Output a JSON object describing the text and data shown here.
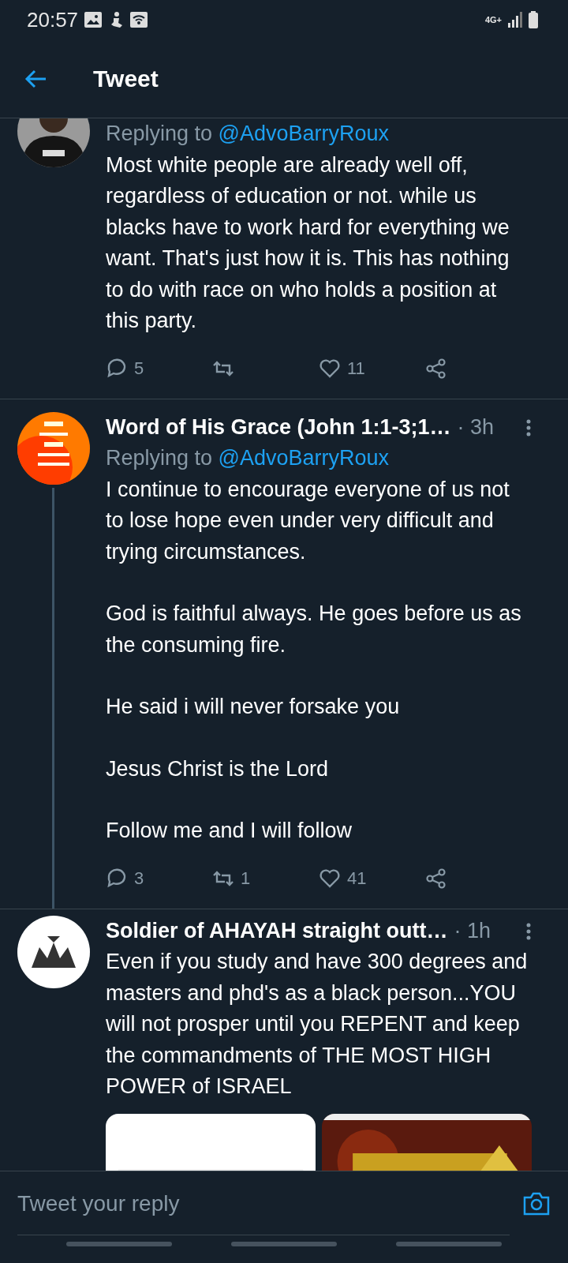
{
  "status_bar": {
    "time": "20:57",
    "network": "4G+"
  },
  "header": {
    "title": "Tweet"
  },
  "tweets": [
    {
      "replying_label": "Replying to",
      "reply_to": "@AdvoBarryRoux",
      "connected": false,
      "paragraphs": [
        "Most white people are already well off, regardless of education or not.  while us blacks have to work hard for everything we want. That's just how it is. This has nothing to do with race on who holds a position at this party."
      ],
      "actions": [
        {
          "kind": "reply",
          "count": "5"
        },
        {
          "kind": "retweet"
        },
        {
          "kind": "like",
          "count": "11"
        },
        {
          "kind": "share"
        }
      ]
    },
    {
      "name": "Word of His Grace (John 1:1-3;1…",
      "time": "· 3h",
      "replying_label": "Replying to",
      "reply_to": "@AdvoBarryRoux",
      "connected": true,
      "paragraphs": [
        "I continue to encourage everyone of us not to lose hope even under very difficult and trying circumstances.",
        "God is faithful always. He goes before us as the consuming fire.",
        "He said i will never forsake you",
        "Jesus Christ is the Lord",
        "Follow me and I will follow"
      ],
      "actions": [
        {
          "kind": "reply",
          "count": "3"
        },
        {
          "kind": "retweet",
          "count": "1"
        },
        {
          "kind": "like",
          "count": "41"
        },
        {
          "kind": "share"
        }
      ]
    },
    {
      "name": "Soldier of AHAYAH straight outt…",
      "time": "· 1h",
      "connected": false,
      "paragraphs": [
        "Even if you study and have 300 degrees and masters and phd's as a black person...YOU will not prosper until you REPENT and keep the commandments of THE MOST HIGH POWER of ISRAEL"
      ],
      "media": [
        {
          "kind": "picture"
        },
        {
          "kind": "picture"
        }
      ]
    }
  ],
  "reply_bar": {
    "placeholder": "Tweet your reply"
  }
}
